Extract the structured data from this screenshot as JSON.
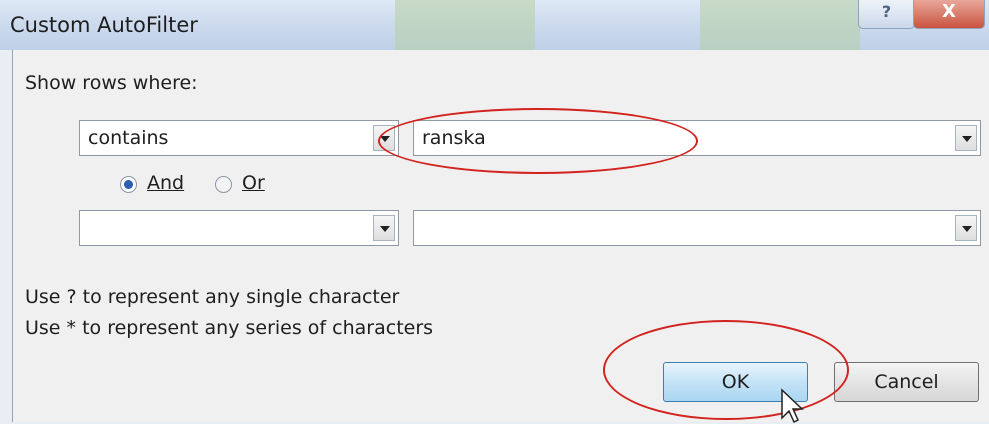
{
  "dialog": {
    "title": "Custom AutoFilter",
    "help_glyph": "?",
    "close_glyph": "X"
  },
  "show_rows_label": "Show rows where:",
  "criteria1": {
    "operator": "contains",
    "value": "ranska"
  },
  "logic": {
    "and_label": "And",
    "or_label": "Or",
    "selected": "And"
  },
  "criteria2": {
    "operator": "",
    "value": ""
  },
  "hints": [
    "Use ? to represent any single character",
    "Use * to represent any series of characters"
  ],
  "buttons": {
    "ok": "OK",
    "cancel": "Cancel"
  },
  "colors": {
    "highlight": "#d2231e",
    "ok_button": "#c4e3f7"
  }
}
